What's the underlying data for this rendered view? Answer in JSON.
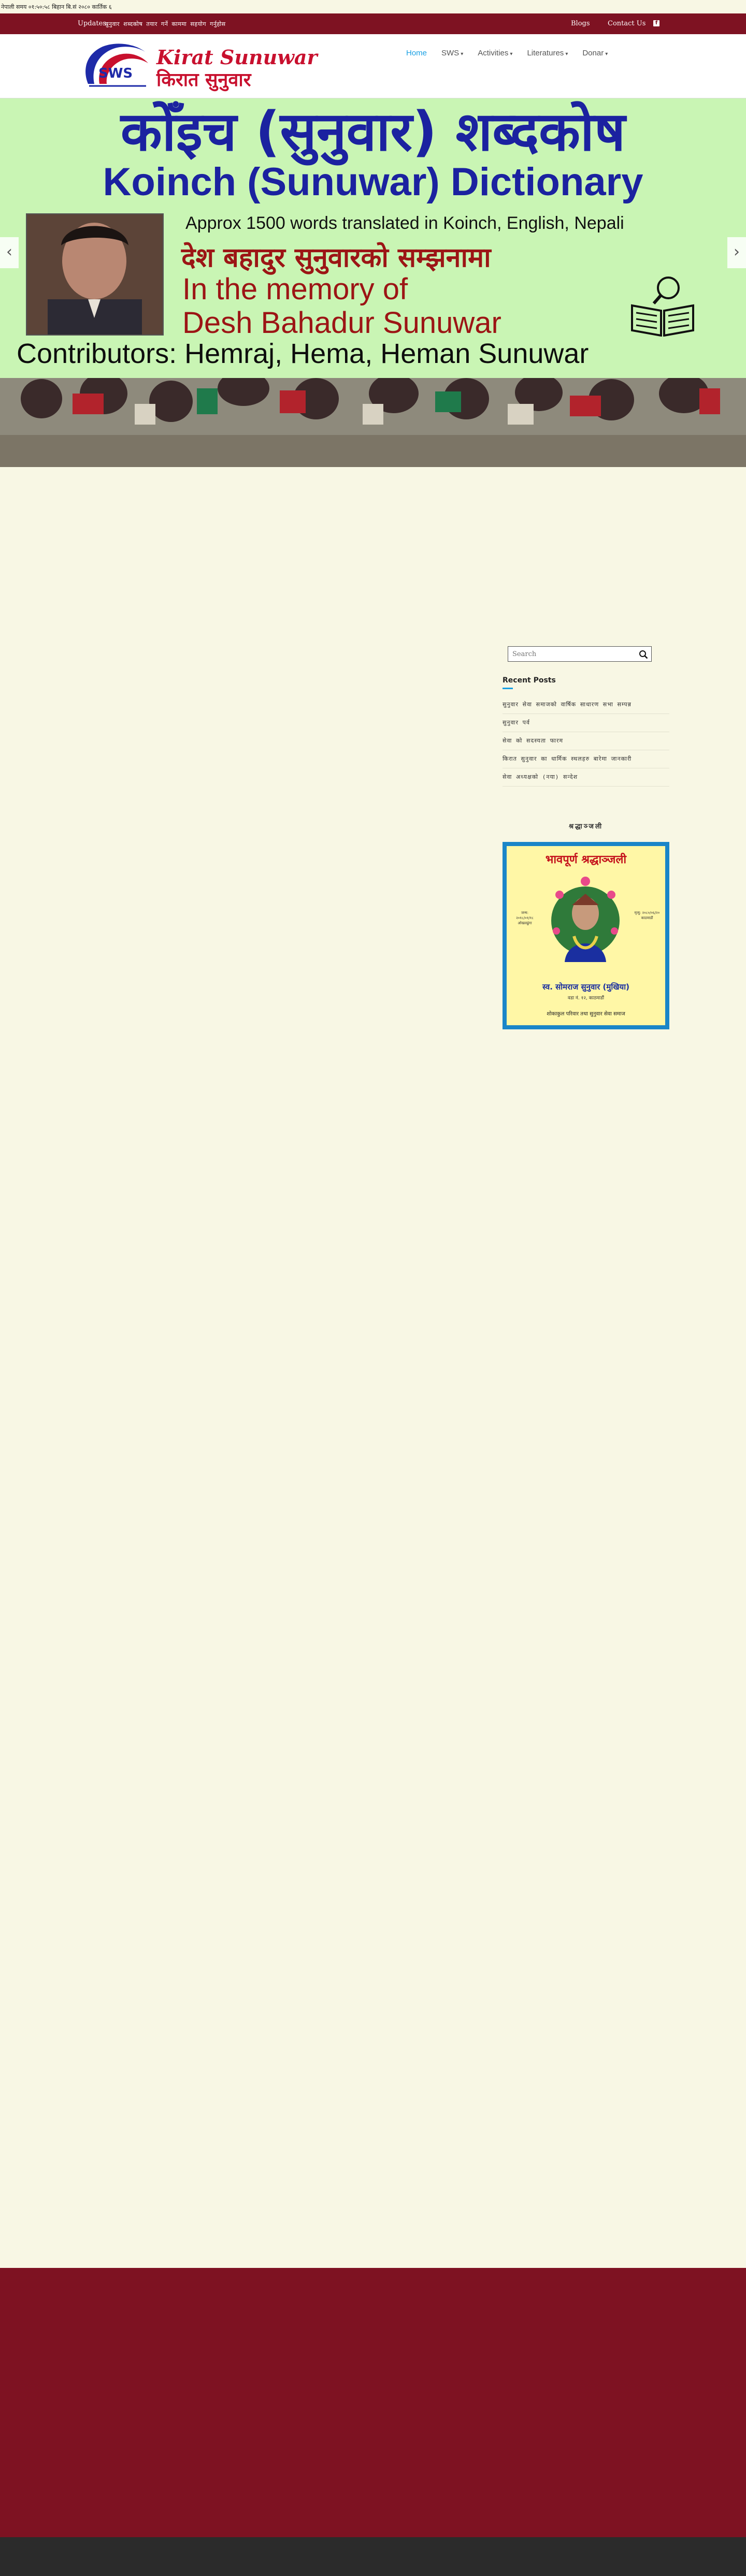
{
  "datebar": {
    "text": "नेपाली समय ०१:५०:५८ बिहान   बि.सं २०८० कार्तिक ६"
  },
  "topbar": {
    "update_label": "Updates:",
    "update_text": "सुनुवार शब्दकोष तयार गर्ने काममा सहयोग गर्नुहोस",
    "links": [
      "Blogs",
      "Contact Us"
    ],
    "social_icon": "facebook-icon"
  },
  "logo": {
    "brand_en": "Kirat Sunuwar",
    "brand_np": "किरात सुनुवार",
    "emblem_text": "SWS"
  },
  "nav": [
    {
      "label": "Home",
      "active": true,
      "has_dropdown": false
    },
    {
      "label": "SWS",
      "active": false,
      "has_dropdown": true
    },
    {
      "label": "Activities",
      "active": false,
      "has_dropdown": true
    },
    {
      "label": "Literatures",
      "active": false,
      "has_dropdown": true
    },
    {
      "label": "Donar",
      "active": false,
      "has_dropdown": true
    }
  ],
  "slider": {
    "title_np": "कोँइच (सुनुवार) शब्दकोष",
    "title_en": "Koinch (Sunuwar) Dictionary",
    "approx": "Approx 1500 words translated in Koinch, English, Nepali",
    "memory_np": "देश बहादुर सुनुवारको सम्झनामा",
    "memory_line1": "In the memory of",
    "memory_line2": "Desh Bahadur Sunuwar",
    "contributors": "Contributors: Hemraj, Hema, Heman Sunuwar",
    "prev_icon": "chevron-left-icon",
    "next_icon": "chevron-right-icon"
  },
  "sidebar": {
    "search_placeholder": "Search",
    "recent_title": "Recent Posts",
    "recent_posts": [
      "सुनुवार सेवा समाजको वार्षिक साधारण सभा सम्पन्न",
      "सुनुवार पर्व",
      "सेवा को सदस्यता फारम",
      "किरात सुनुवार का धार्मिक स्थलहरु बारेमा जानकारी",
      "सेवा अध्यक्षको (नया) सन्देश"
    ],
    "widget2_title": "श्रद्धाञ्जली",
    "tribute": {
      "title": "भावपूर्ण श्रद्धाञ्जली",
      "born": "जन्म: २०१८/०१/१८ ओखलढुंगा",
      "died": "मृत्यु: २०८०/०६/२० काठमाडौं",
      "name": "स्व. सोमराज सुनुवार (मुखिया)",
      "place": "वडा नं. १२, काठमाडौं",
      "family": "शोकाकुल परिवार तथा सुनुवार सेवा समाज"
    }
  },
  "colors": {
    "maroon": "#7e1222",
    "accent_blue": "#1aa0e3",
    "page_bg": "#f8f7e4",
    "banner_green": "#c9f5b4",
    "footer_dark": "#2b2b2b"
  }
}
